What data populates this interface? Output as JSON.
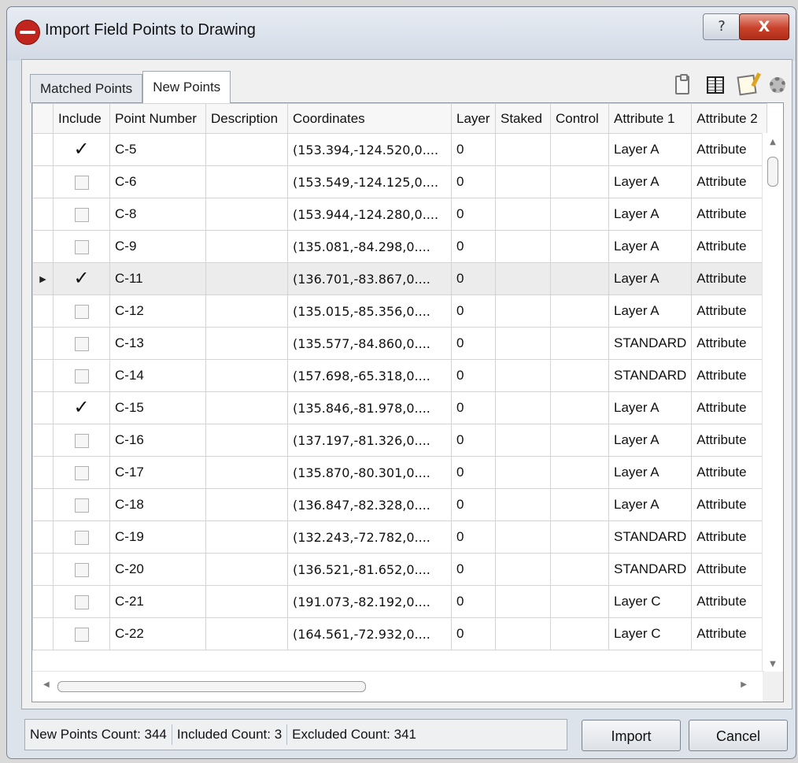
{
  "window": {
    "title": "Import Field Points to Drawing",
    "help_label": "?",
    "close_label": "X"
  },
  "tabs": [
    {
      "label": "Matched Points",
      "active": false
    },
    {
      "label": "New Points",
      "active": true
    }
  ],
  "toolbar_icons": [
    "clipboard-icon",
    "columns-icon",
    "note-icon",
    "settings-gear-icon"
  ],
  "table": {
    "columns": [
      "Include",
      "Point Number",
      "Description",
      "Coordinates",
      "Layer",
      "Staked",
      "Control",
      "Attribute 1",
      "Attribute 2"
    ],
    "rows": [
      {
        "include": true,
        "point": "C-5",
        "description": "",
        "coordinates": "(153.394,-124.520,0....",
        "layer": "0",
        "staked": "",
        "control": "",
        "attr1": "Layer A",
        "attr2": "Attribute"
      },
      {
        "include": false,
        "point": "C-6",
        "description": "",
        "coordinates": "(153.549,-124.125,0....",
        "layer": "0",
        "staked": "",
        "control": "",
        "attr1": "Layer A",
        "attr2": "Attribute"
      },
      {
        "include": false,
        "point": "C-8",
        "description": "",
        "coordinates": "(153.944,-124.280,0....",
        "layer": "0",
        "staked": "",
        "control": "",
        "attr1": "Layer A",
        "attr2": "Attribute"
      },
      {
        "include": false,
        "point": "C-9",
        "description": "",
        "coordinates": "(135.081,-84.298,0....",
        "layer": "0",
        "staked": "",
        "control": "",
        "attr1": "Layer A",
        "attr2": "Attribute"
      },
      {
        "include": true,
        "point": "C-11",
        "description": "",
        "coordinates": "(136.701,-83.867,0....",
        "layer": "0",
        "staked": "",
        "control": "",
        "attr1": "Layer A",
        "attr2": "Attribute",
        "current": true
      },
      {
        "include": false,
        "point": "C-12",
        "description": "",
        "coordinates": "(135.015,-85.356,0....",
        "layer": "0",
        "staked": "",
        "control": "",
        "attr1": "Layer A",
        "attr2": "Attribute"
      },
      {
        "include": false,
        "point": "C-13",
        "description": "",
        "coordinates": "(135.577,-84.860,0....",
        "layer": "0",
        "staked": "",
        "control": "",
        "attr1": "STANDARD",
        "attr2": "Attribute"
      },
      {
        "include": false,
        "point": "C-14",
        "description": "",
        "coordinates": "(157.698,-65.318,0....",
        "layer": "0",
        "staked": "",
        "control": "",
        "attr1": "STANDARD",
        "attr2": "Attribute"
      },
      {
        "include": true,
        "point": "C-15",
        "description": "",
        "coordinates": "(135.846,-81.978,0....",
        "layer": "0",
        "staked": "",
        "control": "",
        "attr1": "Layer A",
        "attr2": "Attribute"
      },
      {
        "include": false,
        "point": "C-16",
        "description": "",
        "coordinates": "(137.197,-81.326,0....",
        "layer": "0",
        "staked": "",
        "control": "",
        "attr1": "Layer A",
        "attr2": "Attribute"
      },
      {
        "include": false,
        "point": "C-17",
        "description": "",
        "coordinates": "(135.870,-80.301,0....",
        "layer": "0",
        "staked": "",
        "control": "",
        "attr1": "Layer A",
        "attr2": "Attribute"
      },
      {
        "include": false,
        "point": "C-18",
        "description": "",
        "coordinates": "(136.847,-82.328,0....",
        "layer": "0",
        "staked": "",
        "control": "",
        "attr1": "Layer A",
        "attr2": "Attribute"
      },
      {
        "include": false,
        "point": "C-19",
        "description": "",
        "coordinates": "(132.243,-72.782,0....",
        "layer": "0",
        "staked": "",
        "control": "",
        "attr1": "STANDARD",
        "attr2": "Attribute"
      },
      {
        "include": false,
        "point": "C-20",
        "description": "",
        "coordinates": "(136.521,-81.652,0....",
        "layer": "0",
        "staked": "",
        "control": "",
        "attr1": "STANDARD",
        "attr2": "Attribute"
      },
      {
        "include": false,
        "point": "C-21",
        "description": "",
        "coordinates": "(191.073,-82.192,0....",
        "layer": "0",
        "staked": "",
        "control": "",
        "attr1": "Layer C",
        "attr2": "Attribute"
      },
      {
        "include": false,
        "point": "C-22",
        "description": "",
        "coordinates": "(164.561,-72.932,0....",
        "layer": "0",
        "staked": "",
        "control": "",
        "attr1": "Layer C",
        "attr2": "Attribute"
      }
    ]
  },
  "status": {
    "new_points": "New Points Count:  344",
    "included": "Included Count:  3",
    "excluded": "Excluded Count:  341"
  },
  "buttons": {
    "import": "Import",
    "cancel": "Cancel"
  },
  "colors": {
    "close_button": "#c8412b",
    "app_icon": "#c0261d"
  }
}
